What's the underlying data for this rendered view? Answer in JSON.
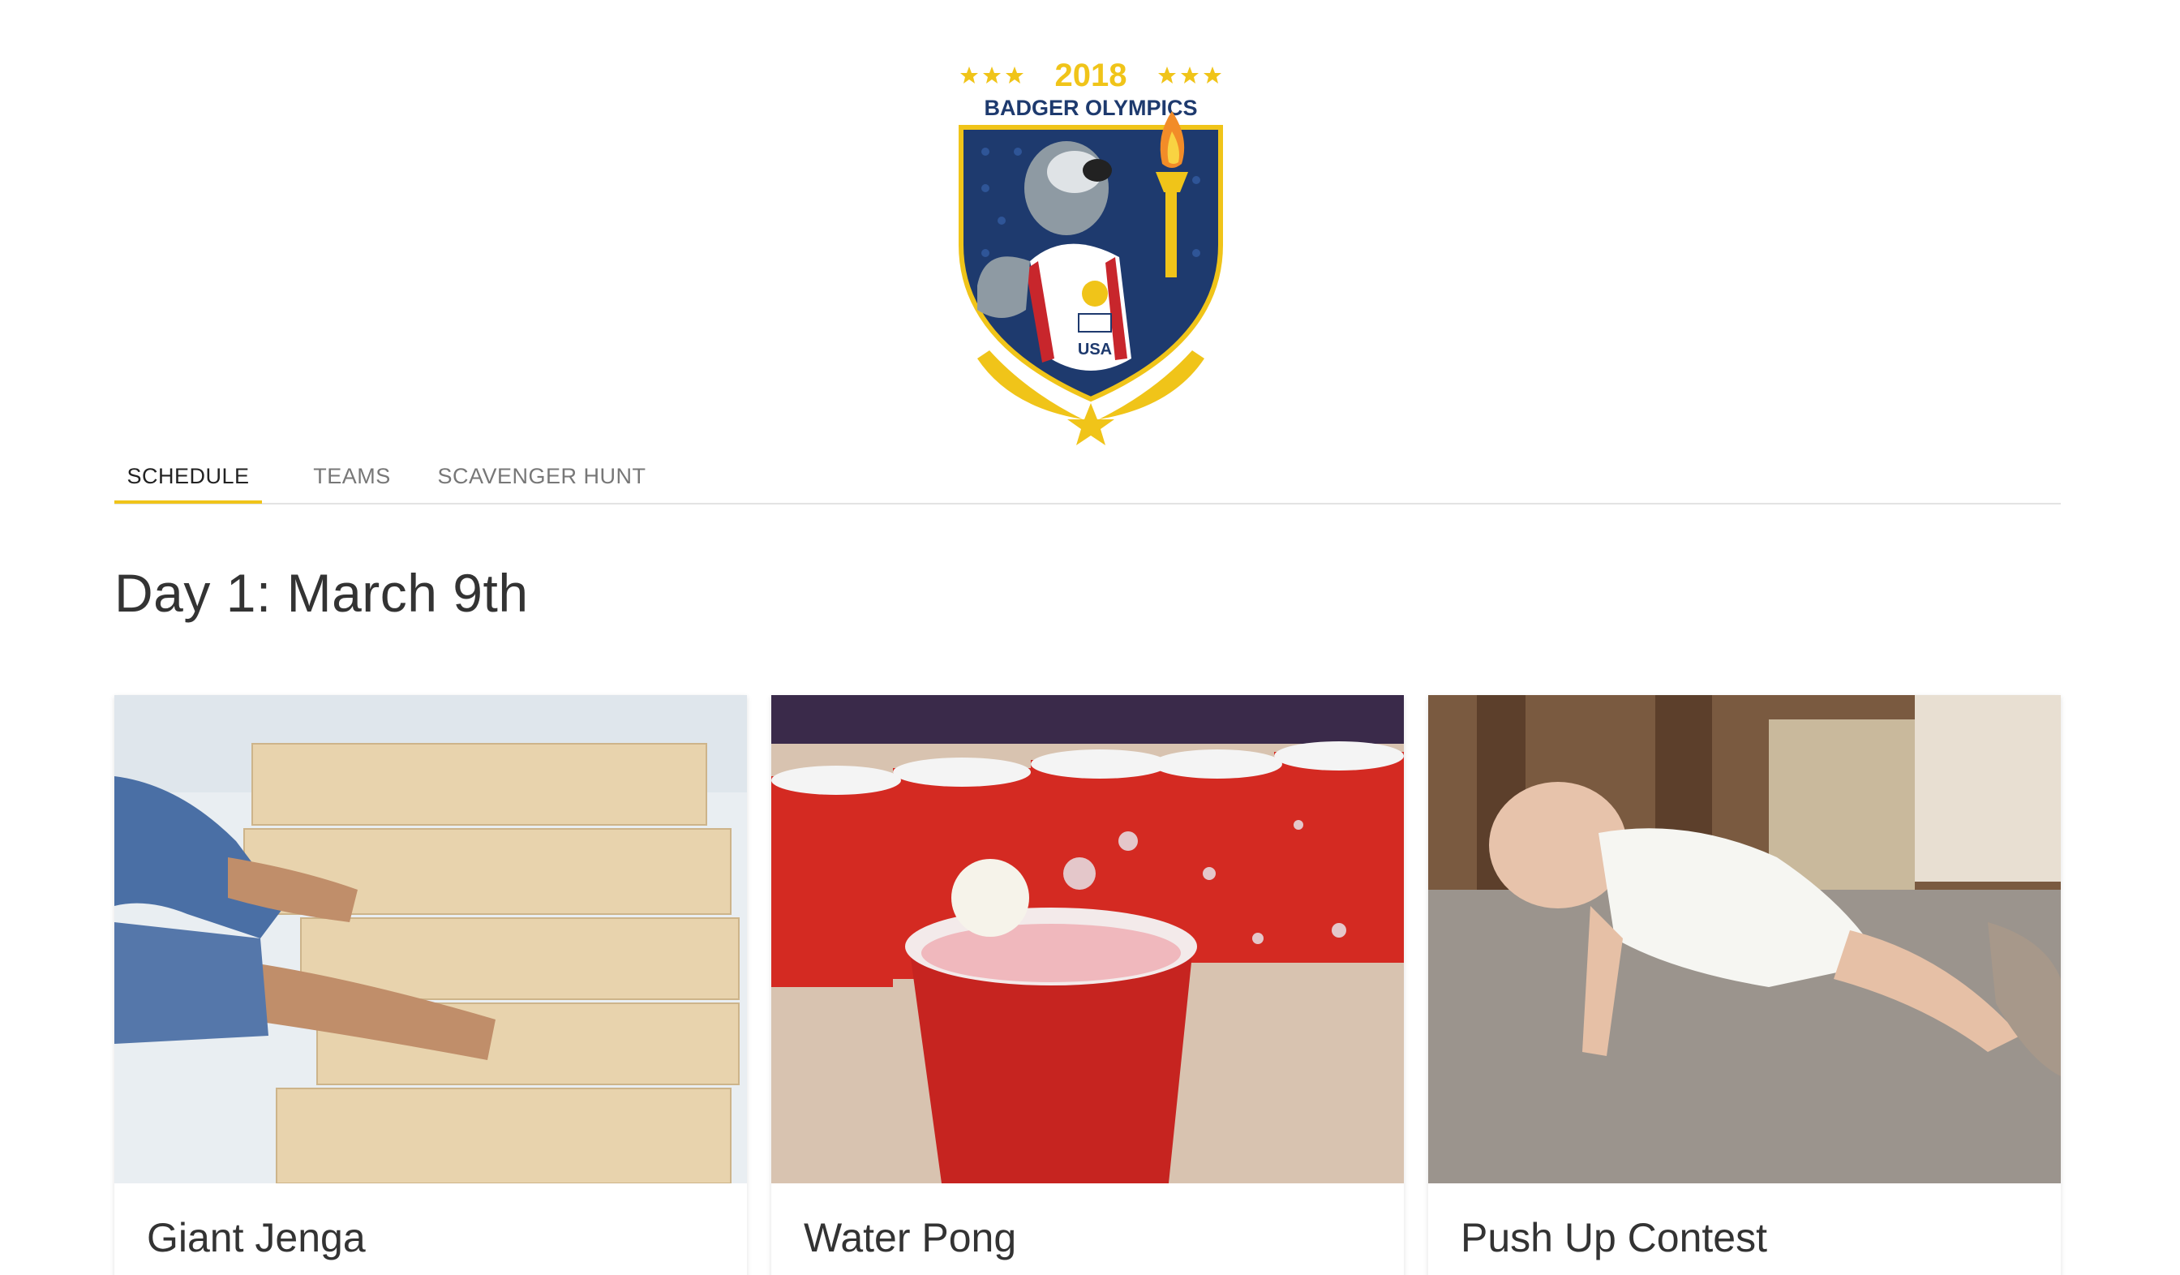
{
  "logo": {
    "year": "2018",
    "name": "BADGER OLYMPICS",
    "jersey": "USA"
  },
  "nav": {
    "tabs": [
      {
        "label": "SCHEDULE",
        "active": true
      },
      {
        "label": "TEAMS",
        "active": false
      },
      {
        "label": "SCAVENGER HUNT",
        "active": false
      }
    ],
    "accent": "#f0c419"
  },
  "schedule": {
    "day_title": "Day 1: March 9th",
    "events": [
      {
        "title": "Giant Jenga"
      },
      {
        "title": "Water Pong"
      },
      {
        "title": "Push Up Contest"
      }
    ]
  }
}
